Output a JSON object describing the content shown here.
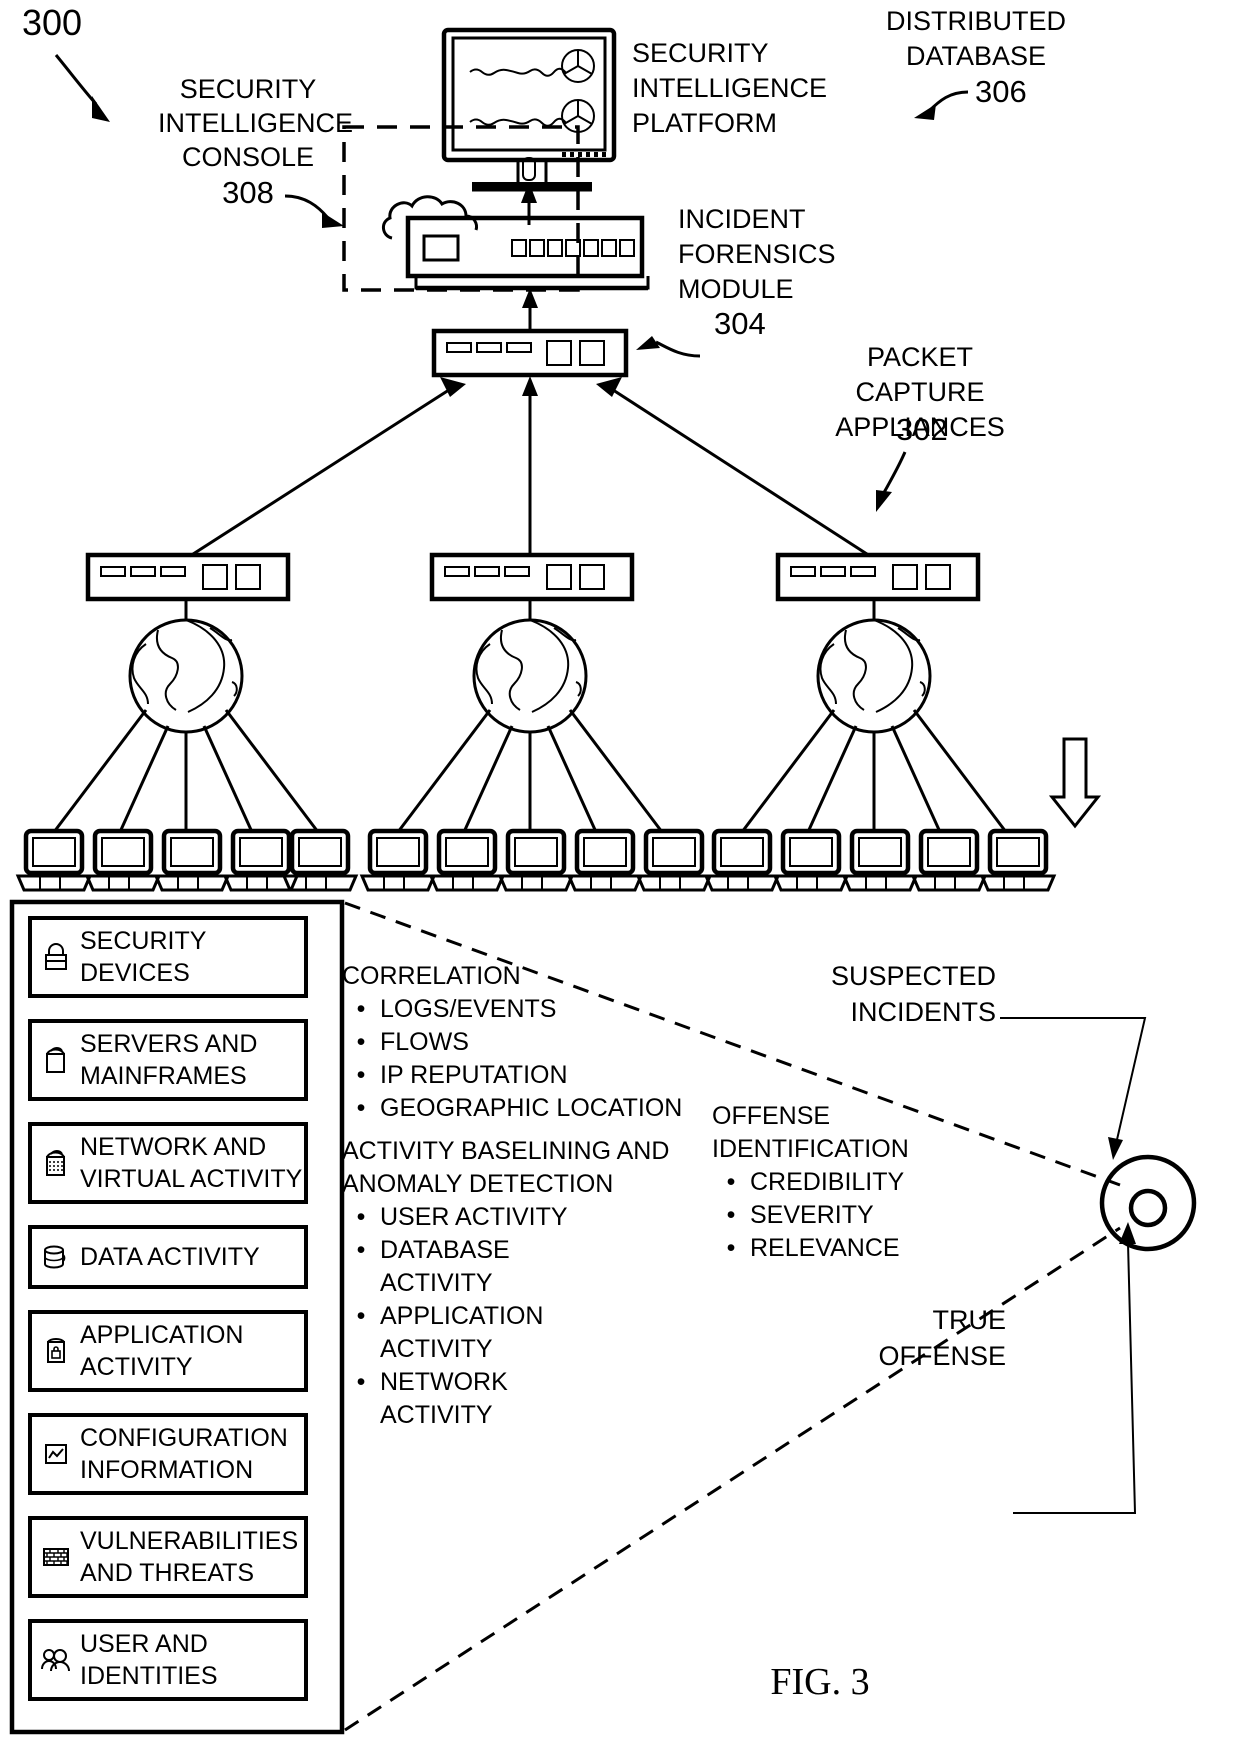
{
  "figure": {
    "number": "300",
    "caption": "FIG. 3"
  },
  "callouts": {
    "security_intelligence_console": {
      "lines": [
        "SECURITY",
        "INTELLIGENCE",
        "CONSOLE"
      ],
      "ref": "308"
    },
    "security_intelligence_platform": {
      "lines": [
        "SECURITY",
        "INTELLIGENCE",
        "PLATFORM"
      ]
    },
    "distributed_database": {
      "lines": [
        "DISTRIBUTED",
        "DATABASE"
      ],
      "ref": "306"
    },
    "incident_forensics_module": {
      "lines": [
        "INCIDENT",
        "FORENSICS",
        "MODULE"
      ],
      "ref": "304"
    },
    "packet_capture_appliances": {
      "lines": [
        "PACKET CAPTURE",
        "APPLIANCES"
      ],
      "ref": "302"
    },
    "suspected_incidents": {
      "lines": [
        "SUSPECTED",
        "INCIDENTS"
      ]
    },
    "true_offense": {
      "lines": [
        "TRUE",
        "OFFENSE"
      ]
    }
  },
  "data_sources": [
    {
      "icon": "padlock-icon",
      "lines": [
        "SECURITY",
        "DEVICES"
      ]
    },
    {
      "icon": "server-icon",
      "lines": [
        "SERVERS AND",
        "MAINFRAMES"
      ]
    },
    {
      "icon": "network-icon",
      "lines": [
        "NETWORK AND",
        "VIRTUAL ACTIVITY"
      ]
    },
    {
      "icon": "database-icon",
      "lines": [
        "DATA ACTIVITY"
      ]
    },
    {
      "icon": "application-icon",
      "lines": [
        "APPLICATION",
        "ACTIVITY"
      ]
    },
    {
      "icon": "chart-icon",
      "lines": [
        "CONFIGURATION",
        "INFORMATION"
      ]
    },
    {
      "icon": "brickwall-icon",
      "lines": [
        "VULNERABILITIES",
        "AND THREATS"
      ]
    },
    {
      "icon": "users-icon",
      "lines": [
        "USER AND",
        "IDENTITIES"
      ]
    }
  ],
  "analysis_groups": [
    {
      "title_lines": [
        "CORRELATION"
      ],
      "bullets": [
        [
          "LOGS/EVENTS"
        ],
        [
          "FLOWS"
        ],
        [
          "IP REPUTATION"
        ],
        [
          "GEOGRAPHIC LOCATION"
        ]
      ]
    },
    {
      "title_lines": [
        "ACTIVITY BASELINING AND",
        "ANOMALY DETECTION"
      ],
      "bullets": [
        [
          "USER ACTIVITY"
        ],
        [
          "DATABASE",
          "ACTIVITY"
        ],
        [
          "APPLICATION",
          "ACTIVITY"
        ],
        [
          "NETWORK",
          "ACTIVITY"
        ]
      ]
    },
    {
      "title_lines": [
        "OFFENSE",
        "IDENTIFICATION"
      ],
      "bullets": [
        [
          "CREDIBILITY"
        ],
        [
          "SEVERITY"
        ],
        [
          "RELEVANCE"
        ]
      ]
    }
  ],
  "colors": {
    "ink": "#000000",
    "paper": "#ffffff"
  }
}
